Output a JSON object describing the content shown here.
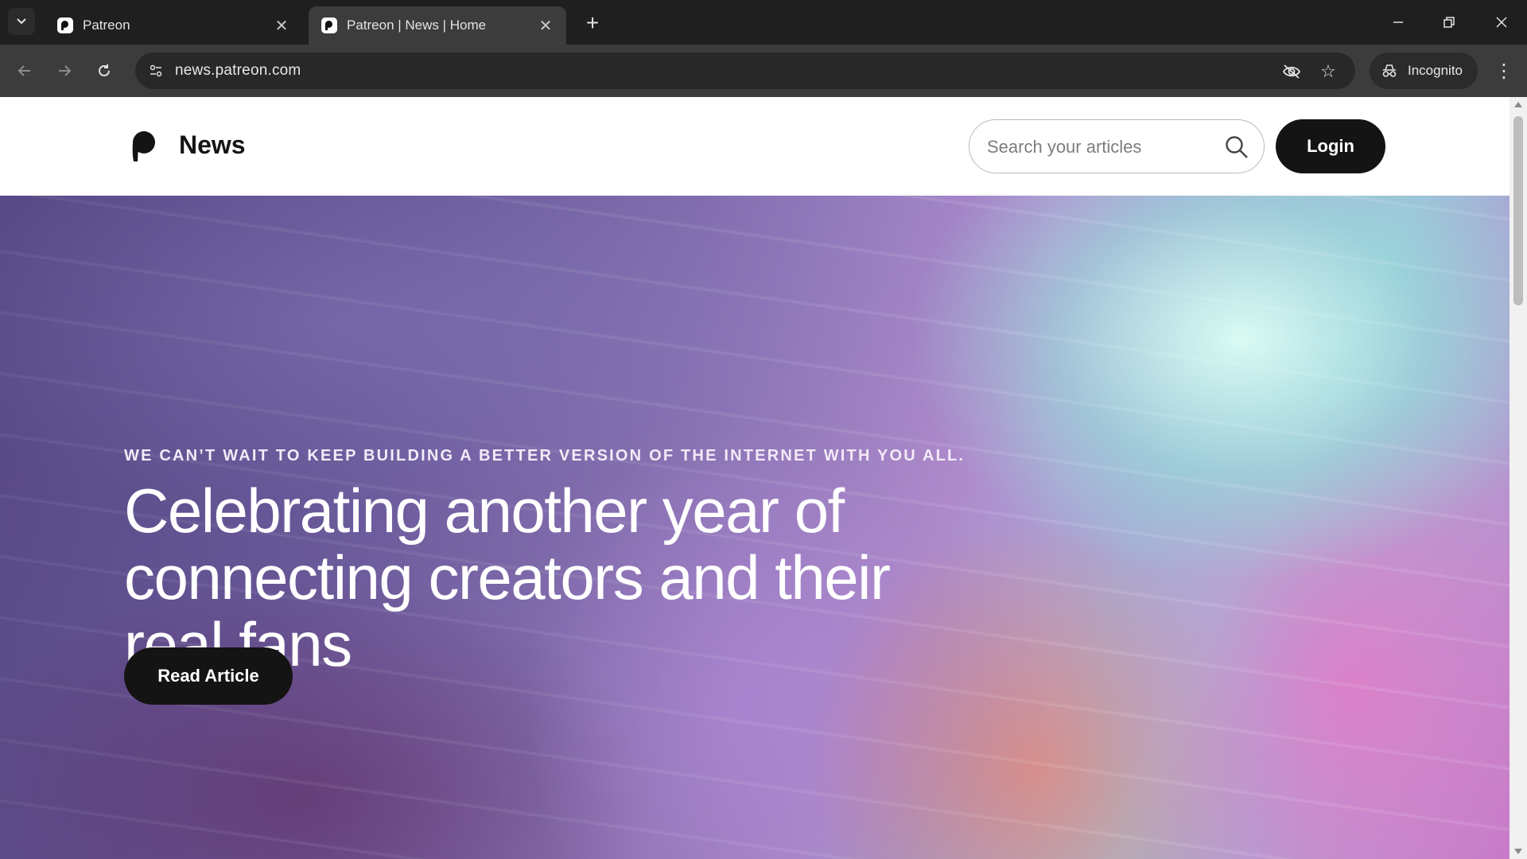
{
  "browser": {
    "tabs": [
      {
        "title": "Patreon",
        "active": false
      },
      {
        "title": "Patreon | News | Home",
        "active": true
      }
    ],
    "url": "news.patreon.com",
    "incognito_label": "Incognito"
  },
  "header": {
    "brand": "News",
    "search_placeholder": "Search your articles",
    "login_label": "Login"
  },
  "hero": {
    "kicker": "WE CAN’T WAIT TO KEEP BUILDING A BETTER VERSION OF THE INTERNET WITH YOU ALL.",
    "headline": "Celebrating another year of connecting creators and their real fans",
    "cta_label": "Read Article"
  },
  "colors": {
    "chrome_dark": "#1f1f1f",
    "chrome_toolbar": "#3c3c3c",
    "button_dark": "#141414",
    "page_bg": "#ffffff"
  }
}
